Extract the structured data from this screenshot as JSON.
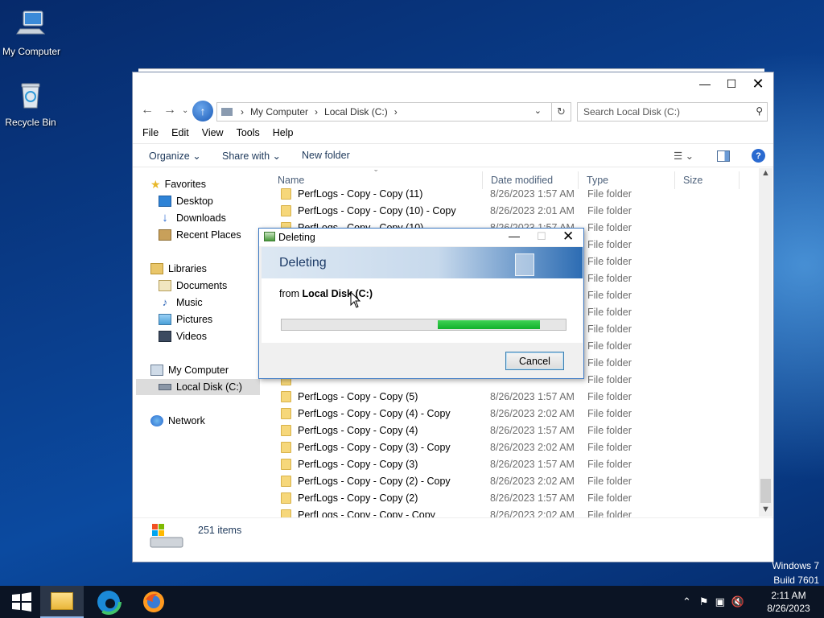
{
  "desktop": {
    "icons": [
      {
        "label": "My Computer"
      },
      {
        "label": "Recycle Bin"
      }
    ],
    "watermark": {
      "line1": "Windows 7",
      "line2": "Build 7601"
    }
  },
  "explorer": {
    "breadcrumb": [
      "My Computer",
      "Local Disk (C:)"
    ],
    "search_placeholder": "Search Local Disk (C:)",
    "menu": [
      "File",
      "Edit",
      "View",
      "Tools",
      "Help"
    ],
    "toolbar": {
      "organize": "Organize",
      "share_with": "Share with",
      "new_folder": "New folder"
    },
    "nav": {
      "favorites": "Favorites",
      "favorites_items": [
        "Desktop",
        "Downloads",
        "Recent Places"
      ],
      "libraries": "Libraries",
      "libraries_items": [
        "Documents",
        "Music",
        "Pictures",
        "Videos"
      ],
      "computer": "My Computer",
      "computer_items": [
        "Local Disk (C:)"
      ],
      "network": "Network"
    },
    "columns": [
      "Name",
      "Date modified",
      "Type",
      "Size"
    ],
    "rows": [
      {
        "name": "PerfLogs - Copy - Copy (11)",
        "date": "8/26/2023 1:57 AM",
        "type": "File folder"
      },
      {
        "name": "PerfLogs - Copy - Copy (10) - Copy",
        "date": "8/26/2023 2:01 AM",
        "type": "File folder"
      },
      {
        "name": "PerfLogs - Copy - Copy (10)",
        "date": "8/26/2023 1:57 AM",
        "type": "File folder"
      },
      {
        "name": "",
        "date": "",
        "type": "File folder"
      },
      {
        "name": "",
        "date": "",
        "type": "File folder"
      },
      {
        "name": "",
        "date": "",
        "type": "File folder"
      },
      {
        "name": "",
        "date": "",
        "type": "File folder"
      },
      {
        "name": "",
        "date": "",
        "type": "File folder"
      },
      {
        "name": "",
        "date": "",
        "type": "File folder"
      },
      {
        "name": "",
        "date": "",
        "type": "File folder"
      },
      {
        "name": "",
        "date": "",
        "type": "File folder"
      },
      {
        "name": "",
        "date": "",
        "type": "File folder"
      },
      {
        "name": "PerfLogs - Copy - Copy (5)",
        "date": "8/26/2023 1:57 AM",
        "type": "File folder"
      },
      {
        "name": "PerfLogs - Copy - Copy (4) - Copy",
        "date": "8/26/2023 2:02 AM",
        "type": "File folder"
      },
      {
        "name": "PerfLogs - Copy - Copy (4)",
        "date": "8/26/2023 1:57 AM",
        "type": "File folder"
      },
      {
        "name": "PerfLogs - Copy - Copy (3) - Copy",
        "date": "8/26/2023 2:02 AM",
        "type": "File folder"
      },
      {
        "name": "PerfLogs - Copy - Copy (3)",
        "date": "8/26/2023 1:57 AM",
        "type": "File folder"
      },
      {
        "name": "PerfLogs - Copy - Copy (2) - Copy",
        "date": "8/26/2023 2:02 AM",
        "type": "File folder"
      },
      {
        "name": "PerfLogs - Copy - Copy (2)",
        "date": "8/26/2023 1:57 AM",
        "type": "File folder"
      },
      {
        "name": "PerfLogs - Copy - Copy - Copy",
        "date": "8/26/2023 2:02 AM",
        "type": "File folder"
      }
    ],
    "status": {
      "item_count": "251 items"
    }
  },
  "dialog": {
    "title": "Deleting",
    "heading": "Deleting",
    "from_prefix": "from",
    "from_location": "Local Disk (C:)",
    "progress": {
      "start": 0.55,
      "end": 0.91
    },
    "cancel_label": "Cancel"
  },
  "taskbar": {
    "time": "2:11 AM",
    "date": "8/26/2023"
  }
}
